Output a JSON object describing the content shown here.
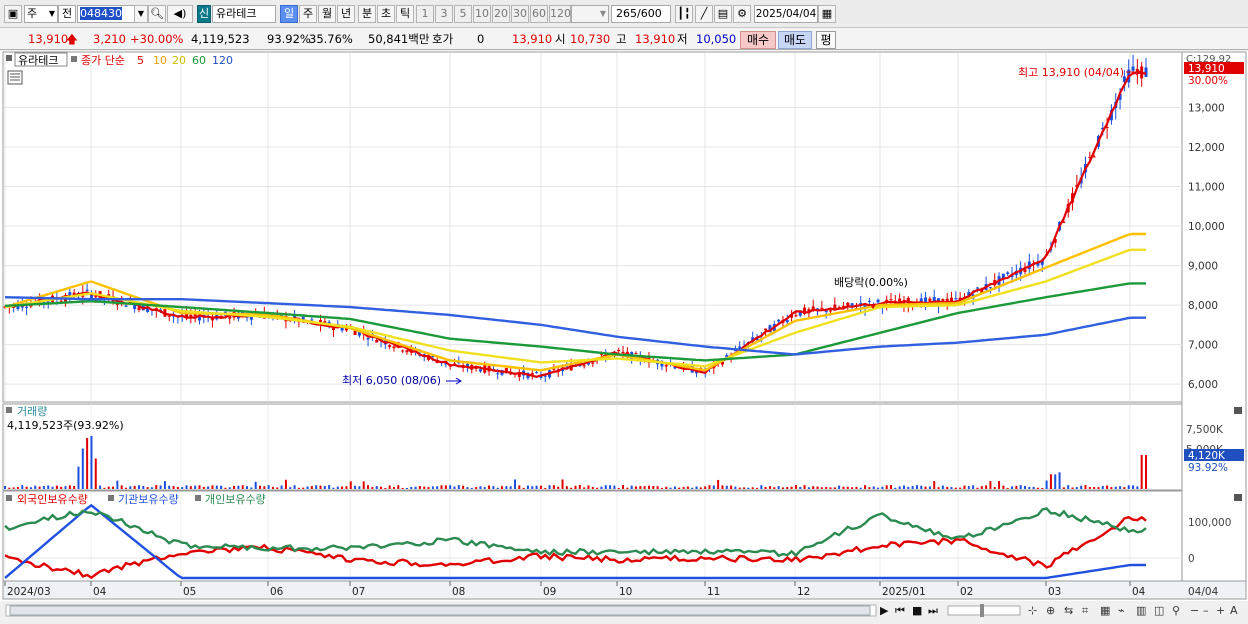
{
  "toolbar": {
    "period_type": "주",
    "market_prefix": "전",
    "stock_code": "048430",
    "credit_badge": "신",
    "stock_name": "유라테크",
    "intervals": [
      "일",
      "주",
      "월",
      "년",
      "분",
      "초",
      "틱"
    ],
    "active_interval": "일",
    "minute_counts": [
      "1",
      "3",
      "5",
      "10",
      "20",
      "30",
      "60",
      "120"
    ],
    "count_display": "265",
    "count_max": "/600",
    "date": "2025/04/04"
  },
  "quote": {
    "price": "13,910",
    "change": "3,210",
    "change_pct": "+30.00%",
    "volume": "4,119,523",
    "volume_ratio": "93.92%",
    "turnover": "35.76%",
    "trade_value": "50,841백만",
    "bid_label": "호가",
    "bid_value": "0",
    "bid_price": "13,910",
    "open_label": "시",
    "open": "10,730",
    "high_label": "고",
    "high": "13,910",
    "low_label": "저",
    "low": "10,050",
    "buy_label": "매수",
    "sell_label": "매도",
    "eval_label": "평"
  },
  "price_panel": {
    "name_label": "유라테크",
    "legend_prefix": "종가 단순",
    "ma_periods": [
      "5",
      "10",
      "20",
      "60",
      "120"
    ],
    "ma_colors": [
      "#e00000",
      "#ffc000",
      "#f0e020",
      "#1c9a3a",
      "#3060e0"
    ],
    "max_annotation": "최고 13,910 (04/04)",
    "min_annotation": "최저 6,050 (08/06)",
    "dividend_annotation": "배당락(0.00%)",
    "top_cut_label": "C:129.92",
    "current_price_tag": "13,910",
    "current_pct_tag": "30.00%",
    "y_ticks": [
      "13,000",
      "12,000",
      "11,000",
      "10,000",
      "9,000",
      "8,000",
      "7,000",
      "6,000"
    ]
  },
  "volume_panel": {
    "title": "거래량",
    "value": "4,119,523주(93.92%)",
    "y_ticks": [
      "7,500K",
      "5,000K"
    ],
    "current_tag": "4,120K",
    "current_pct": "93.92%"
  },
  "holdings_panel": {
    "legend": [
      "외국인보유수량",
      "기관보유수량",
      "개인보유수량"
    ],
    "colors": [
      "#e00000",
      "#2050e0",
      "#2a8a50"
    ],
    "y_ticks": [
      "100,000",
      "0"
    ]
  },
  "x_axis": {
    "labels": [
      "2024/03",
      "04",
      "05",
      "06",
      "07",
      "08",
      "09",
      "10",
      "11",
      "12",
      "2025/01",
      "02",
      "03",
      "04"
    ],
    "right_label": "04/04"
  },
  "chart_data": {
    "type": "line",
    "title": "",
    "x": [
      "2024/03",
      "04",
      "05",
      "06",
      "07",
      "08",
      "09",
      "10",
      "11",
      "12",
      "2025/01",
      "02",
      "03",
      "04"
    ],
    "ylim": [
      5700,
      14100
    ],
    "series": [
      {
        "name": "5",
        "values": [
          7950,
          8300,
          7700,
          7750,
          7400,
          6500,
          6200,
          6800,
          6300,
          7800,
          8050,
          8100,
          9200,
          13910
        ]
      },
      {
        "name": "10",
        "values": [
          7950,
          8600,
          7800,
          7760,
          7420,
          6600,
          6350,
          6750,
          6350,
          7600,
          8000,
          8050,
          8950,
          9800
        ]
      },
      {
        "name": "20",
        "values": [
          7950,
          8300,
          7850,
          7700,
          7450,
          6850,
          6550,
          6650,
          6450,
          7300,
          7950,
          8000,
          8600,
          9400
        ]
      },
      {
        "name": "60",
        "values": [
          7980,
          8100,
          7950,
          7800,
          7650,
          7150,
          6950,
          6750,
          6600,
          6750,
          7300,
          7800,
          8200,
          8550
        ]
      },
      {
        "name": "120",
        "values": [
          8200,
          8150,
          8150,
          8050,
          7950,
          7750,
          7500,
          7200,
          6950,
          6750,
          6950,
          7050,
          7250,
          7680
        ]
      }
    ]
  }
}
